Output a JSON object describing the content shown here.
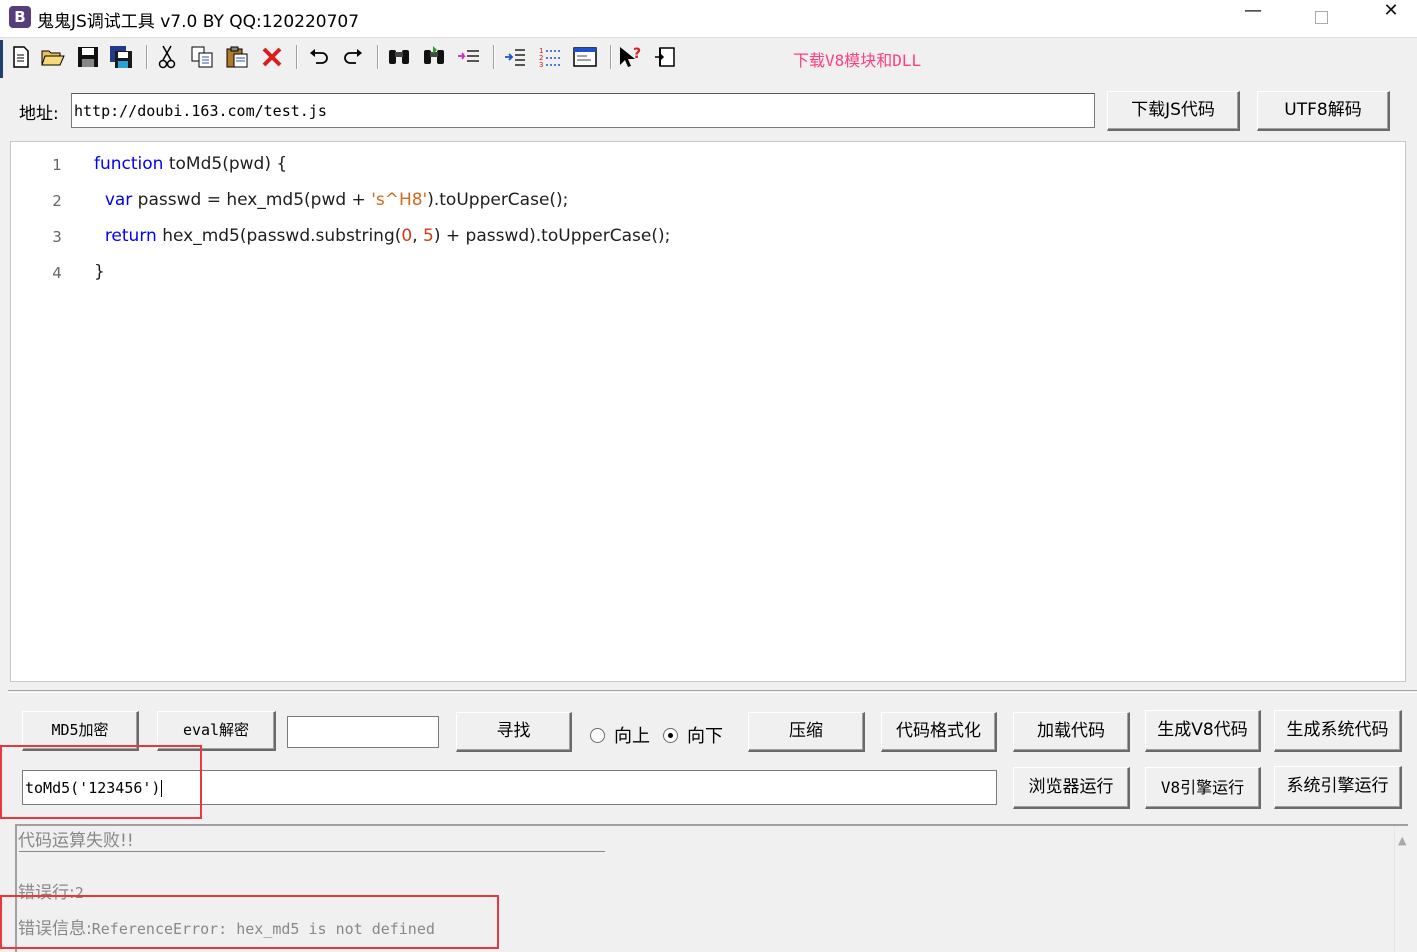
{
  "window": {
    "title": "鬼鬼JS调试工具 v7.0 BY QQ:120220707",
    "app_icon_letter": "B",
    "minimize_glyph": "—",
    "close_glyph": "✕"
  },
  "toolbar": {
    "icons": [
      "new-file",
      "open-folder",
      "save",
      "save-all",
      "cut",
      "copy",
      "paste",
      "delete",
      "undo",
      "redo",
      "find",
      "find-next",
      "replace",
      "indent",
      "numbered-list",
      "browser-window",
      "help-cursor",
      "panel-toggle"
    ],
    "download_link": "下载V8模块和DLL"
  },
  "address": {
    "label": "地址:",
    "url": "http://doubi.163.com/test.js",
    "download_button": "下载JS代码",
    "decode_button": "UTF8解码"
  },
  "editor": {
    "lines": [
      {
        "num": "1",
        "parts": [
          {
            "t": "function",
            "c": "kw"
          },
          {
            "t": " toMd5(pwd) {",
            "c": ""
          }
        ]
      },
      {
        "num": "2",
        "parts": [
          {
            "t": "  ",
            "c": ""
          },
          {
            "t": "var",
            "c": "kw"
          },
          {
            "t": " passwd = hex_md5(pwd + ",
            "c": ""
          },
          {
            "t": "'s^H8'",
            "c": "str"
          },
          {
            "t": ").toUpperCase();",
            "c": ""
          }
        ]
      },
      {
        "num": "3",
        "parts": [
          {
            "t": "  ",
            "c": ""
          },
          {
            "t": "return",
            "c": "kw"
          },
          {
            "t": " hex_md5(passwd.substring(",
            "c": ""
          },
          {
            "t": "0",
            "c": "num"
          },
          {
            "t": ", ",
            "c": ""
          },
          {
            "t": "5",
            "c": "num"
          },
          {
            "t": ") + passwd).toUpperCase();",
            "c": ""
          }
        ]
      },
      {
        "num": "4",
        "parts": [
          {
            "t": "}",
            "c": ""
          }
        ]
      }
    ]
  },
  "controls": {
    "md5_button": "MD5加密",
    "eval_button": "eval解密",
    "search_value": "",
    "find_button": "寻找",
    "radio_up": "向上",
    "radio_down": "向下",
    "radio_selected": "向下",
    "compress_button": "压缩",
    "format_button": "代码格式化",
    "load_button": "加载代码",
    "gen_v8_button": "生成V8代码",
    "gen_sys_button": "生成系统代码",
    "command_value": "toMd5('123456')",
    "browser_run_button": "浏览器运行",
    "v8_run_button": "V8引擎运行",
    "sys_run_button": "系统引擎运行"
  },
  "output": {
    "status": "代码运算失败!!",
    "error_line_label": "错误行:",
    "error_line_value": "2",
    "error_info_label": "错误信息:",
    "error_info_value": "ReferenceError: hex_md5 is not defined"
  },
  "colors": {
    "keyword": "#0000ff",
    "string": "#d36a1a",
    "number": "#d23a1a",
    "link": "#ff3f7f",
    "highlight_box": "#e8383d"
  }
}
